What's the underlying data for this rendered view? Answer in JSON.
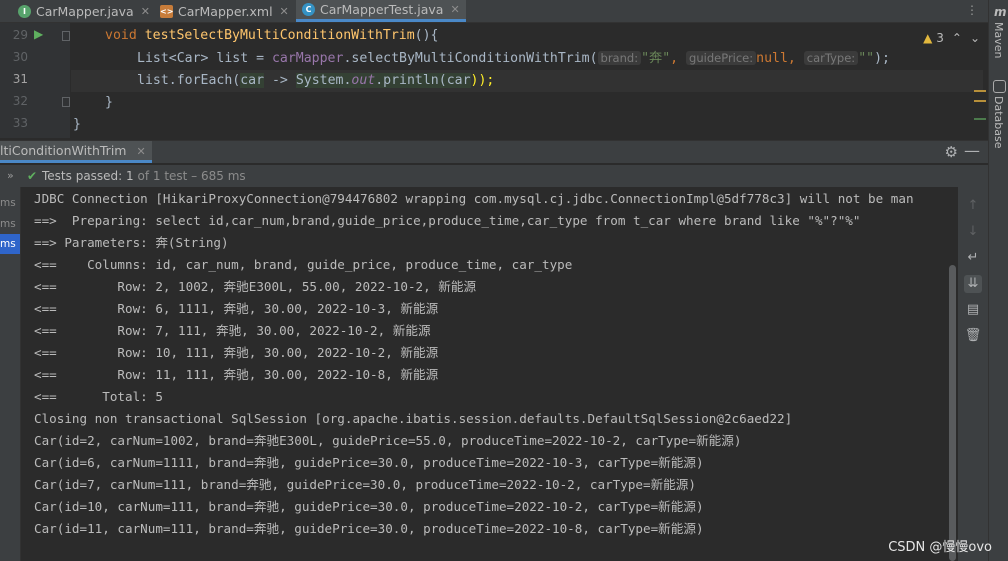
{
  "tabs": [
    {
      "label": "CarMapper.java",
      "icon": "interface-icon",
      "active": false
    },
    {
      "label": "CarMapper.xml",
      "icon": "xml-file-icon",
      "active": false
    },
    {
      "label": "CarMapperTest.java",
      "icon": "class-icon",
      "active": true
    }
  ],
  "right_strip": {
    "maven": "Maven",
    "database": "Database"
  },
  "editor": {
    "warnings_count": "3",
    "lines": [
      {
        "num": "29",
        "void": "void",
        "method": "testSelectByMultiConditionWithTrim",
        "rest": "(){"
      },
      {
        "num": "30",
        "t1": "List<Car> list = ",
        "field": "carMapper",
        "t2": ".selectByMultiConditionWithTrim(",
        "hint1": "brand:",
        "s1": "\"奔\"",
        "comma1": ", ",
        "hint2": "guidePrice:",
        "nullkw": "null",
        "comma2": ", ",
        "hint3": "carType:",
        "s2": "\"\"",
        "end": ");"
      },
      {
        "num": "31",
        "t1": "list.forEach(",
        "param": "car",
        "arrow": " -> ",
        "sys": "System.",
        "out": "out",
        "t2": ".println(",
        "p2": "car",
        "end": "));"
      },
      {
        "num": "32",
        "text": "}"
      },
      {
        "num": "33",
        "text": "}"
      }
    ]
  },
  "run_panel": {
    "tab_label": "ltiConditionWithTrim",
    "status_prefix": "Tests passed: ",
    "status_count": "1",
    "status_rest": " of 1 test – 685 ms"
  },
  "tree_times": [
    "ms",
    "ms",
    "ms"
  ],
  "console_lines": [
    "JDBC Connection [HikariProxyConnection@794476802 wrapping com.mysql.cj.jdbc.ConnectionImpl@5df778c3] will not be man",
    "==>  Preparing: select id,car_num,brand,guide_price,produce_time,car_type from t_car where brand like \"%\"?\"%\"",
    "==> Parameters: 奔(String)",
    "<==    Columns: id, car_num, brand, guide_price, produce_time, car_type",
    "<==        Row: 2, 1002, 奔驰E300L, 55.00, 2022-10-2, 新能源",
    "<==        Row: 6, 1111, 奔驰, 30.00, 2022-10-3, 新能源",
    "<==        Row: 7, 111, 奔驰, 30.00, 2022-10-2, 新能源",
    "<==        Row: 10, 111, 奔驰, 30.00, 2022-10-2, 新能源",
    "<==        Row: 11, 111, 奔驰, 30.00, 2022-10-8, 新能源",
    "<==      Total: 5",
    "Closing non transactional SqlSession [org.apache.ibatis.session.defaults.DefaultSqlSession@2c6aed22]",
    "Car(id=2, carNum=1002, brand=奔驰E300L, guidePrice=55.0, produceTime=2022-10-2, carType=新能源)",
    "Car(id=6, carNum=1111, brand=奔驰, guidePrice=30.0, produceTime=2022-10-3, carType=新能源)",
    "Car(id=7, carNum=111, brand=奔驰, guidePrice=30.0, produceTime=2022-10-2, carType=新能源)",
    "Car(id=10, carNum=111, brand=奔驰, guidePrice=30.0, produceTime=2022-10-2, carType=新能源)",
    "Car(id=11, carNum=111, brand=奔驰, guidePrice=30.0, produceTime=2022-10-8, carType=新能源)"
  ],
  "watermark": "CSDN @慢慢ovo"
}
